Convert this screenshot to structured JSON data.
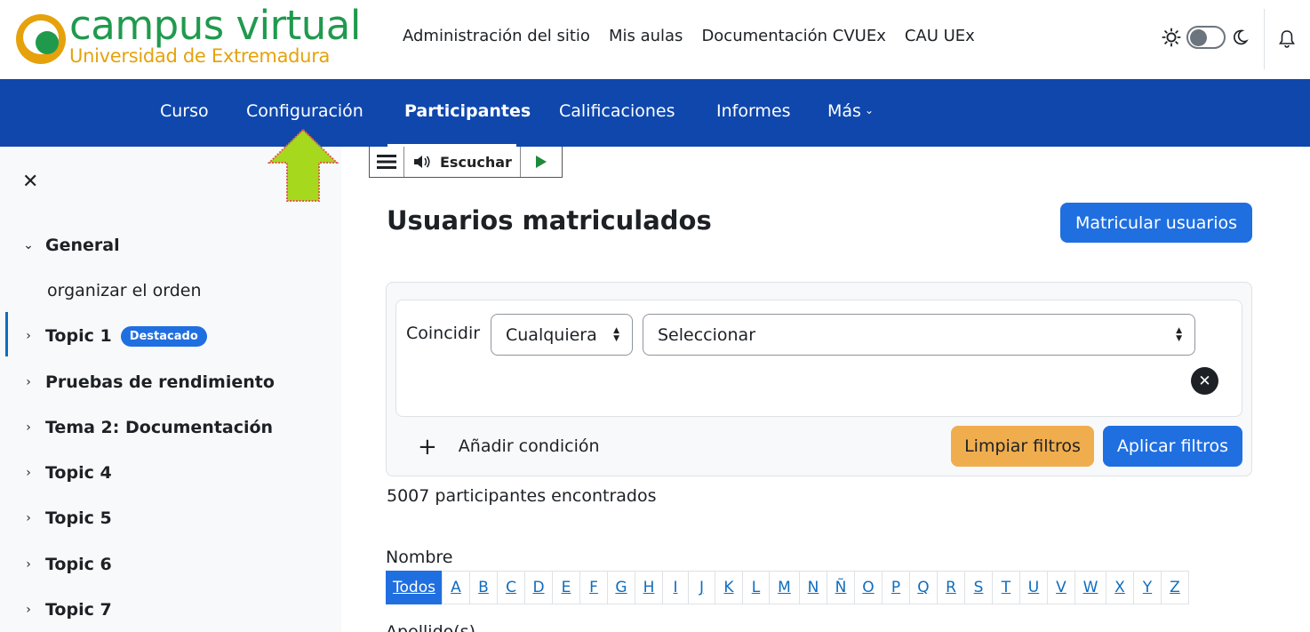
{
  "header": {
    "logo_title": "campus virtual",
    "logo_subtitle": "Universidad de Extremadura",
    "nav": [
      "Administración del sitio",
      "Mis aulas",
      "Documentación CVUEx",
      "CAU UEx"
    ]
  },
  "secondary_nav": {
    "items": [
      "Curso",
      "Configuración",
      "Participantes",
      "Calificaciones",
      "Informes",
      "Más"
    ],
    "active": "Participantes"
  },
  "sidebar": {
    "items": [
      {
        "label": "General",
        "chevron": "down"
      },
      {
        "label": "organizar el orden",
        "chevron": ""
      },
      {
        "label": "Topic 1",
        "chevron": "right",
        "badge": "Destacado"
      },
      {
        "label": "Pruebas de rendimiento",
        "chevron": "right"
      },
      {
        "label": "Tema 2: Documentación",
        "chevron": "right"
      },
      {
        "label": "Topic 4",
        "chevron": "right"
      },
      {
        "label": "Topic 5",
        "chevron": "right"
      },
      {
        "label": "Topic 6",
        "chevron": "right"
      },
      {
        "label": "Topic 7",
        "chevron": "right"
      }
    ]
  },
  "listen_toolbar": {
    "label": "Escuchar"
  },
  "main": {
    "title": "Usuarios matriculados",
    "enrol_button": "Matricular usuarios",
    "filters": {
      "match_label": "Coincidir",
      "match_value": "Cualquiera",
      "field_value": "Seleccionar",
      "add_condition": "Añadir condición",
      "clear_button": "Limpiar filtros",
      "apply_button": "Aplicar filtros"
    },
    "count_text": "5007 participantes encontrados",
    "first_name_label": "Nombre",
    "letters": [
      "Todos",
      "A",
      "B",
      "C",
      "D",
      "E",
      "F",
      "G",
      "H",
      "I",
      "J",
      "K",
      "L",
      "M",
      "N",
      "Ñ",
      "O",
      "P",
      "Q",
      "R",
      "S",
      "T",
      "U",
      "V",
      "W",
      "X",
      "Y",
      "Z"
    ],
    "letters_active": "Todos",
    "last_name_label": "Apellido(s)"
  },
  "colors": {
    "brand_green": "#1f9a4d",
    "brand_orange": "#e5a20c",
    "secondary_nav_bg": "#0f47ad",
    "primary_button": "#1f6fe0",
    "warning_button": "#f0ad4e",
    "annotation_arrow": "#a6d81e"
  }
}
